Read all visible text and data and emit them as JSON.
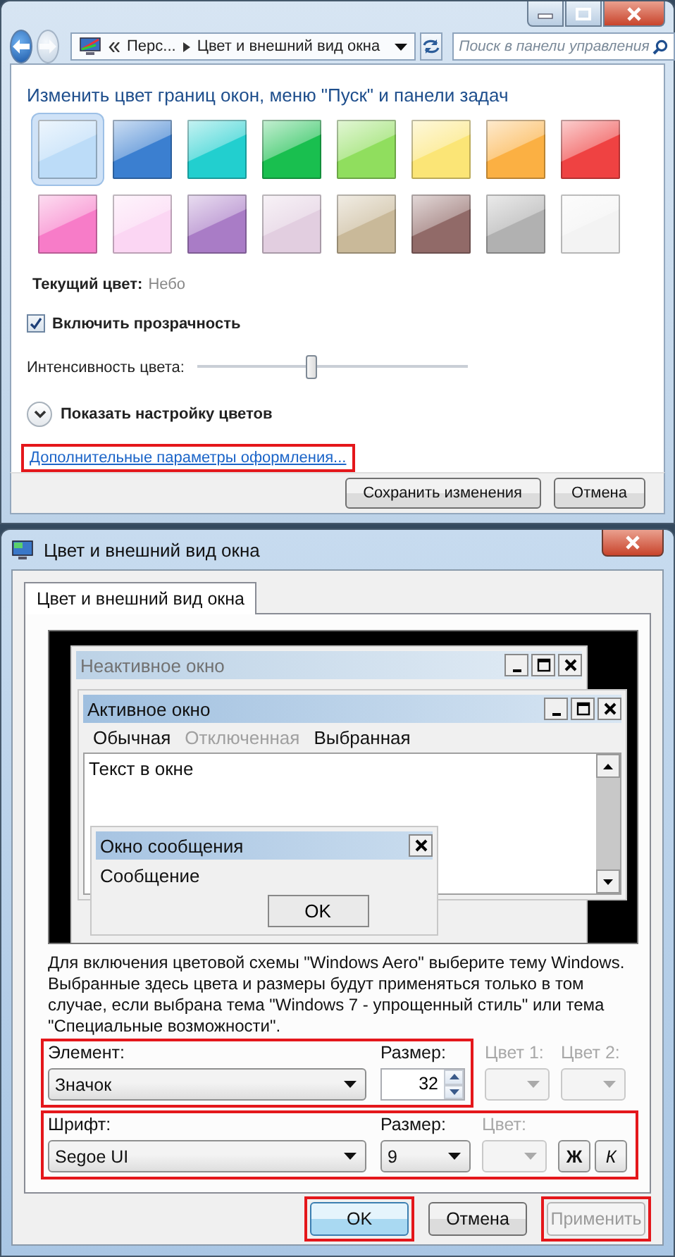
{
  "explorer_window": {
    "address": {
      "crumbs": [
        "Перс...",
        "Цвет и внешний вид окна"
      ]
    },
    "search": {
      "placeholder": "Поиск в панели управления"
    },
    "heading": "Изменить цвет границ окон, меню \"Пуск\" и панели задач",
    "swatches": [
      {
        "color": "#bcdcf8",
        "selected": true
      },
      {
        "color": "#3b7fd0",
        "selected": false
      },
      {
        "color": "#22cfcf",
        "selected": false
      },
      {
        "color": "#19bf4f",
        "selected": false
      },
      {
        "color": "#90de5e",
        "selected": false
      },
      {
        "color": "#fbe576",
        "selected": false
      },
      {
        "color": "#fbb043",
        "selected": false
      },
      {
        "color": "#ef4242",
        "selected": false
      },
      {
        "color": "#f77cc8",
        "selected": false
      },
      {
        "color": "#fbd6f3",
        "selected": false
      },
      {
        "color": "#a97cc6",
        "selected": false
      },
      {
        "color": "#e2cee0",
        "selected": false
      },
      {
        "color": "#c9b999",
        "selected": false
      },
      {
        "color": "#916a68",
        "selected": false
      },
      {
        "color": "#b1b1b1",
        "selected": false
      },
      {
        "color": "#f3f3f3",
        "selected": false
      }
    ],
    "current_color": {
      "label": "Текущий цвет:",
      "value": "Небо"
    },
    "transparency": {
      "label": "Включить прозрачность",
      "checked": true
    },
    "intensity": {
      "label": "Интенсивность цвета:",
      "level": 0.42
    },
    "expander": {
      "label": "Показать настройку цветов",
      "expanded": false
    },
    "advanced_link": {
      "label": "Дополнительные параметры оформления...",
      "highlighted": true
    },
    "buttons": [
      {
        "label": "Сохранить изменения"
      },
      {
        "label": "Отмена"
      }
    ]
  },
  "dialog": {
    "title": "Цвет и внешний вид окна",
    "tabs": [
      {
        "label": "Цвет и внешний вид окна",
        "selected": true
      }
    ],
    "preview": {
      "inactive_window": {
        "title": "Неактивное окно"
      },
      "active_window": {
        "title": "Активное окно",
        "menu": [
          {
            "label": "Обычная",
            "disabled": false
          },
          {
            "label": "Отключенная",
            "disabled": true
          },
          {
            "label": "Выбранная",
            "disabled": false
          }
        ],
        "text": "Текст в окне"
      },
      "message_box": {
        "title": "Окно сообщения",
        "text": "Сообщение",
        "button": "OK"
      }
    },
    "description": "Для включения цветовой схемы \"Windows Aero\" выберите тему Windows. Выбранные здесь цвета и размеры будут применяться только в том случае, если выбрана тема \"Windows 7 - упрощенный стиль\" или тема \"Специальные возможности\".",
    "element_group": {
      "highlighted": true,
      "element": {
        "label": "Элемент:",
        "value": "Значок"
      },
      "size": {
        "label": "Размер:",
        "value": "32"
      }
    },
    "color1": {
      "label": "Цвет 1:",
      "disabled": true
    },
    "color2": {
      "label": "Цвет 2:",
      "disabled": true
    },
    "font_group": {
      "highlighted": true,
      "font": {
        "label": "Шрифт:",
        "value": "Segoe UI"
      },
      "size": {
        "label": "Размер:",
        "value": "9"
      },
      "color": {
        "label": "Цвет:",
        "disabled": true
      },
      "bold": {
        "label": "Ж"
      },
      "italic": {
        "label": "К"
      }
    },
    "buttons": [
      {
        "label": "OK",
        "highlighted": true,
        "disabled": false
      },
      {
        "label": "Отмена",
        "highlighted": false,
        "disabled": false
      },
      {
        "label": "Применить",
        "highlighted": true,
        "disabled": true
      }
    ]
  }
}
